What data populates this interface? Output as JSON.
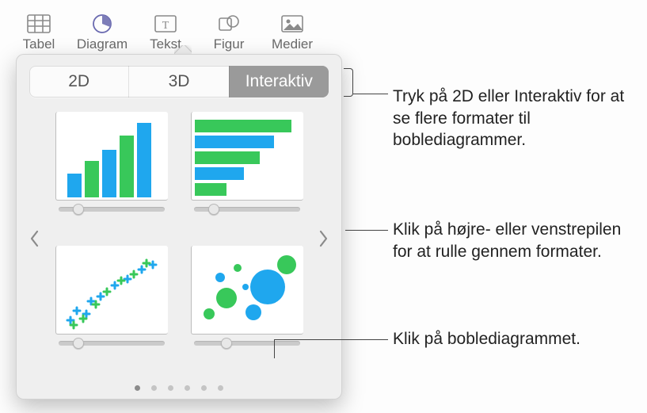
{
  "toolbar": {
    "items": [
      {
        "label": "Tabel",
        "icon": "table-icon"
      },
      {
        "label": "Diagram",
        "icon": "chart-icon",
        "active": true
      },
      {
        "label": "Tekst",
        "icon": "text-icon"
      },
      {
        "label": "Figur",
        "icon": "shape-icon"
      },
      {
        "label": "Medier",
        "icon": "media-icon"
      }
    ]
  },
  "segmented": {
    "options": [
      {
        "label": "2D"
      },
      {
        "label": "3D"
      },
      {
        "label": "Interaktiv",
        "active": true
      }
    ]
  },
  "charts": {
    "thumbs": [
      {
        "type": "column",
        "slider_pos": 0.18
      },
      {
        "type": "bar",
        "slider_pos": 0.18
      },
      {
        "type": "scatter",
        "slider_pos": 0.18
      },
      {
        "type": "bubble",
        "slider_pos": 0.3
      }
    ],
    "palette": {
      "blue": "#1fa7ee",
      "green": "#38c85a"
    }
  },
  "pager": {
    "count": 6,
    "active": 0
  },
  "callouts": {
    "c1": "Tryk på 2D eller Interaktiv for at se flere formater til boblediagrammer.",
    "c2": "Klik på højre- eller venstrepilen for at rulle gennem formater.",
    "c3": "Klik på boblediagrammet."
  }
}
